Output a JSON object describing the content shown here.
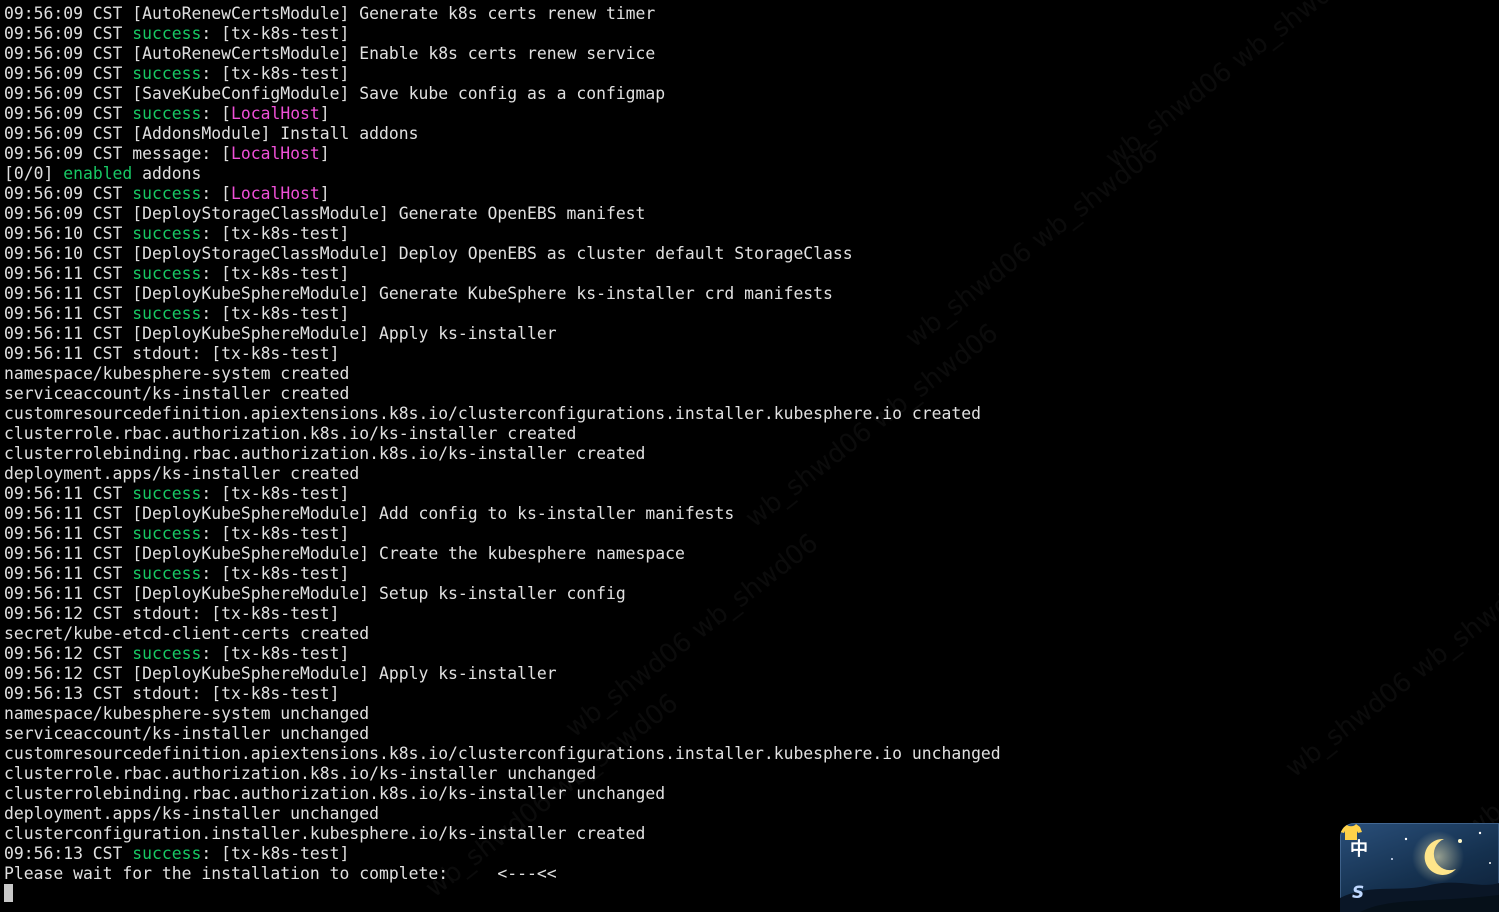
{
  "terminal": {
    "colors": {
      "background": "#000000",
      "text": "#e0e0e0",
      "success": "#17c964",
      "localhost": "#f050d8"
    },
    "lines": [
      [
        {
          "t": "09:56:09 CST [AutoRenewCertsModule] Generate k8s certs renew timer"
        }
      ],
      [
        {
          "t": "09:56:09 CST "
        },
        {
          "t": "success",
          "c": "green"
        },
        {
          "t": ": [tx-k8s-test]"
        }
      ],
      [
        {
          "t": "09:56:09 CST [AutoRenewCertsModule] Enable k8s certs renew service"
        }
      ],
      [
        {
          "t": "09:56:09 CST "
        },
        {
          "t": "success",
          "c": "green"
        },
        {
          "t": ": [tx-k8s-test]"
        }
      ],
      [
        {
          "t": "09:56:09 CST [SaveKubeConfigModule] Save kube config as a configmap"
        }
      ],
      [
        {
          "t": "09:56:09 CST "
        },
        {
          "t": "success",
          "c": "green"
        },
        {
          "t": ": ["
        },
        {
          "t": "LocalHost",
          "c": "magenta"
        },
        {
          "t": "]"
        }
      ],
      [
        {
          "t": "09:56:09 CST [AddonsModule] Install addons"
        }
      ],
      [
        {
          "t": "09:56:09 CST message: ["
        },
        {
          "t": "LocalHost",
          "c": "magenta"
        },
        {
          "t": "]"
        }
      ],
      [
        {
          "t": "[0/0] "
        },
        {
          "t": "enabled",
          "c": "green"
        },
        {
          "t": " addons"
        }
      ],
      [
        {
          "t": "09:56:09 CST "
        },
        {
          "t": "success",
          "c": "green"
        },
        {
          "t": ": ["
        },
        {
          "t": "LocalHost",
          "c": "magenta"
        },
        {
          "t": "]"
        }
      ],
      [
        {
          "t": "09:56:09 CST [DeployStorageClassModule] Generate OpenEBS manifest"
        }
      ],
      [
        {
          "t": "09:56:10 CST "
        },
        {
          "t": "success",
          "c": "green"
        },
        {
          "t": ": [tx-k8s-test]"
        }
      ],
      [
        {
          "t": "09:56:10 CST [DeployStorageClassModule] Deploy OpenEBS as cluster default StorageClass"
        }
      ],
      [
        {
          "t": "09:56:11 CST "
        },
        {
          "t": "success",
          "c": "green"
        },
        {
          "t": ": [tx-k8s-test]"
        }
      ],
      [
        {
          "t": "09:56:11 CST [DeployKubeSphereModule] Generate KubeSphere ks-installer crd manifests"
        }
      ],
      [
        {
          "t": "09:56:11 CST "
        },
        {
          "t": "success",
          "c": "green"
        },
        {
          "t": ": [tx-k8s-test]"
        }
      ],
      [
        {
          "t": "09:56:11 CST [DeployKubeSphereModule] Apply ks-installer"
        }
      ],
      [
        {
          "t": "09:56:11 CST stdout: [tx-k8s-test]"
        }
      ],
      [
        {
          "t": "namespace/kubesphere-system created"
        }
      ],
      [
        {
          "t": "serviceaccount/ks-installer created"
        }
      ],
      [
        {
          "t": "customresourcedefinition.apiextensions.k8s.io/clusterconfigurations.installer.kubesphere.io created"
        }
      ],
      [
        {
          "t": "clusterrole.rbac.authorization.k8s.io/ks-installer created"
        }
      ],
      [
        {
          "t": "clusterrolebinding.rbac.authorization.k8s.io/ks-installer created"
        }
      ],
      [
        {
          "t": "deployment.apps/ks-installer created"
        }
      ],
      [
        {
          "t": "09:56:11 CST "
        },
        {
          "t": "success",
          "c": "green"
        },
        {
          "t": ": [tx-k8s-test]"
        }
      ],
      [
        {
          "t": "09:56:11 CST [DeployKubeSphereModule] Add config to ks-installer manifests"
        }
      ],
      [
        {
          "t": "09:56:11 CST "
        },
        {
          "t": "success",
          "c": "green"
        },
        {
          "t": ": [tx-k8s-test]"
        }
      ],
      [
        {
          "t": "09:56:11 CST [DeployKubeSphereModule] Create the kubesphere namespace"
        }
      ],
      [
        {
          "t": "09:56:11 CST "
        },
        {
          "t": "success",
          "c": "green"
        },
        {
          "t": ": [tx-k8s-test]"
        }
      ],
      [
        {
          "t": "09:56:11 CST [DeployKubeSphereModule] Setup ks-installer config"
        }
      ],
      [
        {
          "t": "09:56:12 CST stdout: [tx-k8s-test]"
        }
      ],
      [
        {
          "t": "secret/kube-etcd-client-certs created"
        }
      ],
      [
        {
          "t": "09:56:12 CST "
        },
        {
          "t": "success",
          "c": "green"
        },
        {
          "t": ": [tx-k8s-test]"
        }
      ],
      [
        {
          "t": "09:56:12 CST [DeployKubeSphereModule] Apply ks-installer"
        }
      ],
      [
        {
          "t": "09:56:13 CST stdout: [tx-k8s-test]"
        }
      ],
      [
        {
          "t": "namespace/kubesphere-system unchanged"
        }
      ],
      [
        {
          "t": "serviceaccount/ks-installer unchanged"
        }
      ],
      [
        {
          "t": "customresourcedefinition.apiextensions.k8s.io/clusterconfigurations.installer.kubesphere.io unchanged"
        }
      ],
      [
        {
          "t": "clusterrole.rbac.authorization.k8s.io/ks-installer unchanged"
        }
      ],
      [
        {
          "t": "clusterrolebinding.rbac.authorization.k8s.io/ks-installer unchanged"
        }
      ],
      [
        {
          "t": "deployment.apps/ks-installer unchanged"
        }
      ],
      [
        {
          "t": "clusterconfiguration.installer.kubesphere.io/ks-installer created"
        }
      ],
      [
        {
          "t": "09:56:13 CST "
        },
        {
          "t": "success",
          "c": "green"
        },
        {
          "t": ": [tx-k8s-test]"
        }
      ],
      [
        {
          "t": "Please wait for the installation to complete:     <---<<"
        }
      ]
    ]
  },
  "watermark": {
    "text": "wb_shwd06"
  },
  "ime": {
    "label": "中",
    "shirt_icon": "tshirt-icon",
    "s_glyph": "S",
    "moon_icon": "crescent-moon-icon"
  }
}
